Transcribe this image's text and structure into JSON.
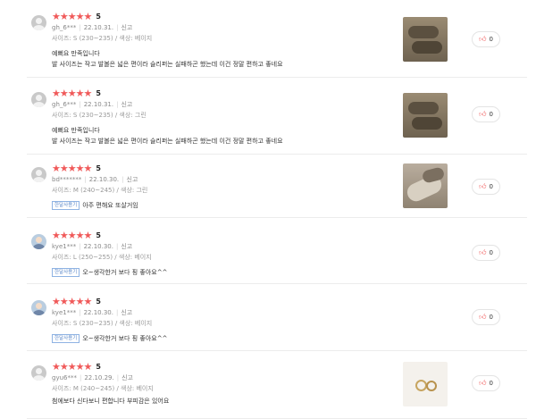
{
  "reviews": [
    {
      "rating": "5",
      "user": "gh_6***",
      "date": "22.10.31.",
      "report": "신고",
      "options": "사이즈: S (230~235) / 색상: 베이지",
      "badge": "",
      "text_line1": "예뻐요 만족입니다",
      "text_line2": "발 사이즈는 작고 발볼은 넓은 편이라 슬리퍼는 실패하곤 했는데 이건 정말 편하고 좋네요",
      "likes": "0",
      "has_photo": true
    },
    {
      "rating": "5",
      "user": "gh_6***",
      "date": "22.10.31.",
      "report": "신고",
      "options": "사이즈: S (230~235) / 색상: 그린",
      "badge": "",
      "text_line1": "예뻐요 만족입니다",
      "text_line2": "발 사이즈는 작고 발볼은 넓은 편이라 슬리퍼는 실패하곤 했는데 이건 정말 편하고 좋네요",
      "likes": "0",
      "has_photo": true
    },
    {
      "rating": "5",
      "user": "bd*******",
      "date": "22.10.30.",
      "report": "신고",
      "options": "사이즈: M (240~245) / 색상: 그린",
      "badge": "한달사용기",
      "text_line1": "아주 편해요 또살거임",
      "text_line2": "",
      "likes": "0",
      "has_photo": true
    },
    {
      "rating": "5",
      "user": "kye1***",
      "date": "22.10.30.",
      "report": "신고",
      "options": "사이즈: L (250~255) / 색상: 베이지",
      "badge": "한달사용기",
      "text_line1": "오~생각한거 보다 핑 좋아요^^",
      "text_line2": "",
      "likes": "0",
      "has_photo": false
    },
    {
      "rating": "5",
      "user": "kye1***",
      "date": "22.10.30.",
      "report": "신고",
      "options": "사이즈: S (230~235) / 색상: 베이지",
      "badge": "한달사용기",
      "text_line1": "오~생각한거 보다 핑 좋아요^^",
      "text_line2": "",
      "likes": "0",
      "has_photo": false
    },
    {
      "rating": "5",
      "user": "gyu6***",
      "date": "22.10.29.",
      "report": "신고",
      "options": "사이즈: M (240~245) / 색상: 베이지",
      "badge": "",
      "text_line1": "첨에보다 신다보니 편합니다 부피감은 있어요",
      "text_line2": "",
      "likes": "0",
      "has_photo": true
    }
  ],
  "icons": {
    "star": "★",
    "like": "thumbs-up-icon"
  },
  "colors": {
    "star": "#f05a5a",
    "badge": "#5b88c9"
  }
}
